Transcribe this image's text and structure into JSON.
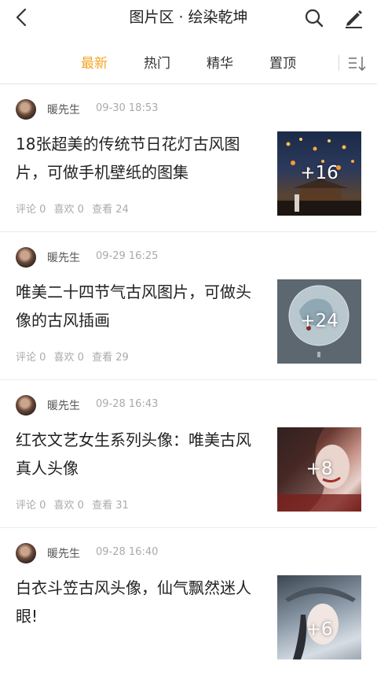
{
  "header": {
    "title": "图片区 · 绘染乾坤",
    "icons": {
      "back": "chevron-left-icon",
      "search": "search-icon",
      "edit": "pencil-icon"
    }
  },
  "tabs": [
    {
      "label": "最新",
      "active": true
    },
    {
      "label": "热门",
      "active": false
    },
    {
      "label": "精华",
      "active": false
    },
    {
      "label": "置顶",
      "active": false
    }
  ],
  "sort_icon": "sort-descending-icon",
  "accent_color": "#f5a623",
  "posts": [
    {
      "author": "暖先生",
      "time": "09-30 18:53",
      "title": "18张超美的传统节日花灯古风图片，可做手机壁纸的图集",
      "comments": "评论 0",
      "likes": "喜欢 0",
      "views": "查看 24",
      "image_count": "+16"
    },
    {
      "author": "暖先生",
      "time": "09-29 16:25",
      "title": "唯美二十四节气古风图片，可做头像的古风插画",
      "comments": "评论 0",
      "likes": "喜欢 0",
      "views": "查看 29",
      "image_count": "+24"
    },
    {
      "author": "暖先生",
      "time": "09-28 16:43",
      "title": "红衣文艺女生系列头像：唯美古风真人头像",
      "comments": "评论 0",
      "likes": "喜欢 0",
      "views": "查看 31",
      "image_count": "+8"
    },
    {
      "author": "暖先生",
      "time": "09-28 16:40",
      "title": "白衣斗笠古风头像，仙气飘然迷人眼!",
      "comments": "",
      "likes": "",
      "views": "",
      "image_count": "+6"
    }
  ]
}
